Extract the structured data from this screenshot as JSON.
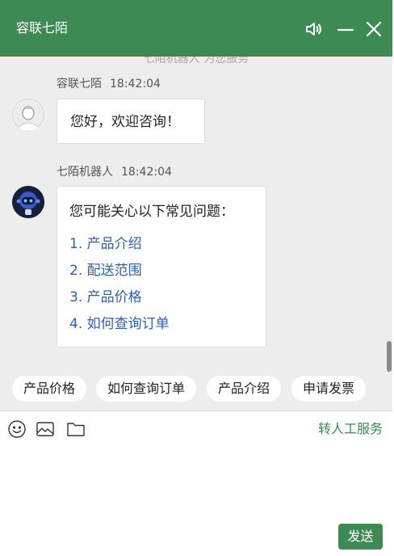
{
  "header": {
    "title": "容联七陌",
    "icons": [
      "speaker-icon",
      "minimize-icon",
      "close-icon"
    ]
  },
  "chat": {
    "notice": "七陌机器人 为您服务",
    "messages": [
      {
        "sender": "容联七陌",
        "time": "18:42:04",
        "avatar": "user-avatar",
        "text": "您好，欢迎咨询！"
      },
      {
        "sender": "七陌机器人",
        "time": "18:42:04",
        "avatar": "robot-avatar",
        "intro": "您可能关心以下常见问题：",
        "items": [
          "1. 产品介绍",
          "2. 配送范围",
          "3. 产品价格",
          "4. 如何查询订单"
        ]
      }
    ]
  },
  "quick_replies": [
    "产品价格",
    "如何查询订单",
    "产品介绍",
    "申请发票"
  ],
  "toolbar": {
    "icons": [
      "emoji-icon",
      "image-icon",
      "folder-icon"
    ],
    "transfer_label": "转人工服务"
  },
  "composer": {
    "value": "",
    "send_label": "发送"
  },
  "colors": {
    "brand": "#3e8a55",
    "link": "#2f5fb3",
    "background": "#ededed"
  }
}
